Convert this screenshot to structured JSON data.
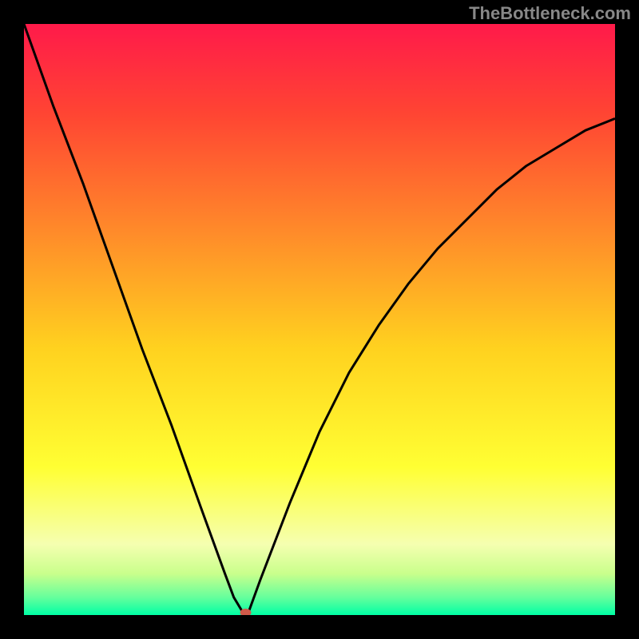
{
  "watermark": "TheBottleneck.com",
  "chart_data": {
    "type": "line",
    "title": "",
    "xlabel": "",
    "ylabel": "",
    "xlim": [
      0,
      100
    ],
    "ylim": [
      0,
      100
    ],
    "description": "Bottleneck curve over a red-to-green gradient. Minimum at x≈37.5 reaches y≈0 (green zone); curve rises steeply toward both edges.",
    "series": [
      {
        "name": "bottleneck-curve",
        "x": [
          0,
          5,
          10,
          15,
          20,
          25,
          30,
          34,
          35.5,
          37,
          37.5,
          38,
          40,
          45,
          50,
          55,
          60,
          65,
          70,
          75,
          80,
          85,
          90,
          95,
          100
        ],
        "y": [
          100,
          86,
          73,
          59,
          45,
          32,
          18,
          7,
          3,
          0.5,
          0,
          0.5,
          6,
          19,
          31,
          41,
          49,
          56,
          62,
          67,
          72,
          76,
          79,
          82,
          84
        ]
      }
    ],
    "marker": {
      "x": 37.5,
      "y": 0,
      "color": "#d05a4a"
    },
    "gradient_stops": [
      {
        "offset": 0.0,
        "color": "#ff1a4a"
      },
      {
        "offset": 0.15,
        "color": "#ff4433"
      },
      {
        "offset": 0.35,
        "color": "#ff8a2a"
      },
      {
        "offset": 0.55,
        "color": "#ffd21f"
      },
      {
        "offset": 0.75,
        "color": "#ffff33"
      },
      {
        "offset": 0.88,
        "color": "#f5ffb0"
      },
      {
        "offset": 0.93,
        "color": "#c9ff8c"
      },
      {
        "offset": 0.97,
        "color": "#66ff9c"
      },
      {
        "offset": 1.0,
        "color": "#00ffa5"
      }
    ]
  }
}
